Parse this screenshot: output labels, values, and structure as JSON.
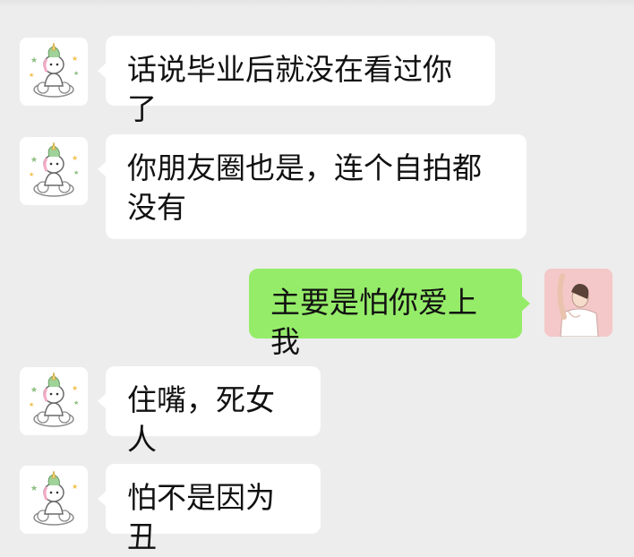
{
  "colors": {
    "background": "#ededed",
    "incoming_bubble": "#ffffff",
    "outgoing_bubble": "#95ec69",
    "text": "#111111"
  },
  "messages": [
    {
      "direction": "incoming",
      "avatar": "unicorn-avatar",
      "text": "话说毕业后就没在看过你了"
    },
    {
      "direction": "incoming",
      "avatar": "unicorn-avatar",
      "text": "你朋友圈也是，连个自拍都没有"
    },
    {
      "direction": "outgoing",
      "avatar": "girl-avatar",
      "text": "主要是怕你爱上我"
    },
    {
      "direction": "incoming",
      "avatar": "unicorn-avatar",
      "text": "住嘴，死女人"
    },
    {
      "direction": "incoming",
      "avatar": "unicorn-avatar",
      "text": "怕不是因为丑"
    }
  ]
}
